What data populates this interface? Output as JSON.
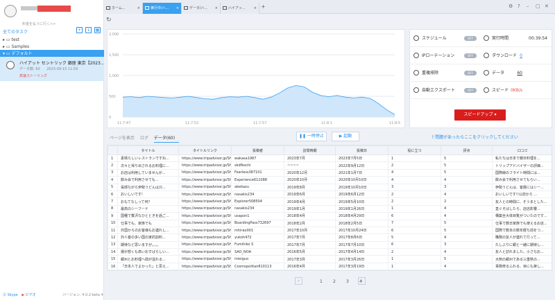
{
  "sidebar": {
    "user_hint": "料金を払うに行く>>",
    "all_tasks": "全てのタスク",
    "items": [
      {
        "label": "test"
      },
      {
        "label": "Samples"
      },
      {
        "label": "デフォルト"
      }
    ],
    "task": {
      "title": "ハイアット セントリック 銀座 東京【2023...",
      "date_label": "データ数: 60",
      "date": "2023-09-15 11:59",
      "status": "高速ストーリング"
    },
    "footer": {
      "skype": "Skype",
      "video": "ビデオ",
      "version": "バージョン: 4.0.2-beta 4"
    }
  },
  "tabs": [
    {
      "label": "ホーム..."
    },
    {
      "label": "実行中/ハ..."
    },
    {
      "label": "データ/ハ..."
    },
    {
      "label": "ハイアッ..."
    }
  ],
  "chart_data": {
    "type": "area",
    "x_ticks": [
      "11:7:47",
      "11:7:52",
      "11:7:57",
      "11:8:1",
      "11:8:5"
    ],
    "y_ticks": [
      "2,000",
      "1,500",
      "1,000",
      "500",
      "0"
    ],
    "ylim": [
      0,
      2000
    ],
    "values": [
      480,
      490,
      470,
      500,
      485,
      470,
      460,
      480,
      500,
      470,
      440,
      430,
      470,
      490,
      480,
      500,
      470,
      430,
      480,
      580,
      700,
      760,
      730,
      600,
      520,
      490,
      520,
      480,
      460,
      480,
      450,
      330,
      180,
      60
    ],
    "color": "#3aa0f0"
  },
  "panel": {
    "schedule": "スケジュール",
    "schedule_state": "OFF",
    "runtime": "実行時間",
    "runtime_val": "00:39:54",
    "ip": "IPローテーション",
    "ip_state": "OFF",
    "download": "ダウンロード",
    "download_val": "0",
    "dedupe": "重複排除",
    "dedupe_state": "OFF",
    "data": "データ",
    "data_val": "60",
    "export": "自動エクスポート",
    "export_state": "OFF",
    "speed": "スピード",
    "speed_val": "0KB/s",
    "speedup": "スピードアップ"
  },
  "main": {
    "tab_page": "ページを表示",
    "tab_log": "ログ",
    "tab_data": "データ(60)",
    "pause": "一時停止",
    "start": "起動",
    "help": "問題があったらここをクリックしてください"
  },
  "table": {
    "headers": [
      "",
      "タイトル",
      "タイトルリンク",
      "投稿者",
      "訪問時期",
      "投稿日",
      "役に立つ",
      "評点",
      "口コミ"
    ],
    "rows": [
      [
        "1",
        "素晴らしいレストランですね...",
        "https://www.tripadvisor.jp/Sho...",
        "wakasa1987",
        "2023年7月",
        "2023年7月5日",
        "1",
        "5",
        "私たちは日本で朝日料理を..."
      ],
      [
        "2",
        "次々と帰り出されるお料理に...",
        "https://www.tripadvisor.jp/Sho...",
        "skdfkochi",
        "~~~~",
        "2022年9月12日",
        "2",
        "5",
        "トリップアドバイザーの評価..."
      ],
      [
        "3",
        "お店は利用していませんが...",
        "https://www.tripadvisor.jp/Sho...",
        "Fearless387101",
        "2020年12月",
        "2021年1月7日",
        "4",
        "5",
        "国際線のフライト時間には..."
      ],
      [
        "4",
        "飲み会で利用させても...",
        "https://www.tripadvisor.jp/Sho...",
        "Experience611088",
        "2020年10月",
        "2020年10月10日",
        "4",
        "4",
        "飲み会で利用させてもらい..."
      ],
      [
        "5",
        "張感ながら伊勢うどんは只...",
        "https://www.tripadvisor.jp/Sho...",
        "abekazu",
        "2019年8月",
        "2019年10月10日",
        "3",
        "3",
        "伊勢うどんは、客層にはシー..."
      ],
      [
        "6",
        "おいしいです!",
        "https://www.tripadvisor.jp/Sho...",
        "nasakis234",
        "2019年6月",
        "2019年6月12日",
        "2",
        "4",
        "おいしいです!!以前から ..."
      ],
      [
        "7",
        "おもてなしって何?",
        "https://www.tripadvisor.jp/Sho...",
        "Explorer508504",
        "2019年4月",
        "2019年5月10日",
        "2",
        "2",
        "友人との時間に、そうまとした..."
      ],
      [
        "8",
        "最高のシーフード",
        "https://www.tripadvisor.jp/Sho...",
        "nasakis234",
        "2019年1月",
        "2019年1月26日",
        "1",
        "4",
        "直ぐそばしたら、店店影響..."
      ],
      [
        "9",
        "国種で贅沢なひとときを過ご...",
        "https://www.tripadvisor.jp/Sho...",
        "usapon1",
        "2018年4月",
        "2018年4月29日",
        "6",
        "4",
        "構築全大体目覧がついたのです..."
      ],
      [
        "10",
        "仕事でも、家族でも",
        "https://www.tripadvisor.jp/Sho...",
        "BoardingPass732697",
        "2018年2月",
        "2018年2月5日",
        "7",
        "5",
        "仕事で数日家族でも使えるお店..."
      ],
      [
        "11",
        "外国からのお客様もお連れし...",
        "https://www.tripadvisor.jp/Sho...",
        "mhirao001",
        "2017年10月",
        "2017年10月24日",
        "6",
        "5",
        "国際で数本の数年経ち前をつ..."
      ],
      [
        "12",
        "外人客の多い国の家的割料...",
        "https://www.tripadvisor.jp/Sho...",
        "yukoh472",
        "2017年7月",
        "2017年8月6日",
        "5",
        "4",
        "職務の友人が連れて行って..."
      ],
      [
        "13",
        "期待など思いますが。。。。",
        "https://www.tripadvisor.jp/Sho...",
        "Fumihiko S",
        "2017年7月",
        "2017年7月10日",
        "6",
        "3",
        "久しぶりに銀と一緒に期待し..."
      ],
      [
        "14",
        "揚が想くも高いおすばらしい...",
        "https://www.tripadvisor.jp/Sho...",
        "SAO_NOA",
        "2016年5月",
        "2017年4月14日",
        "2",
        "4",
        "友人と訪れました。小さなお..."
      ],
      [
        "15",
        "銀州とお料理へ興が溢れる...",
        "https://www.tripadvisor.jp/Sho...",
        "mieiguo",
        "2017年3月",
        "2017年3月26日",
        "1",
        "5",
        "大剤の銀州である三重県の..."
      ],
      [
        "16",
        "「日本人でよかった」と思え...",
        "https://www.tripadvisor.jp/Sho...",
        "Cosmopolitan810113",
        "2016年4月",
        "2017年3月19日",
        "1",
        "4",
        "事態修るふれる、目にも楽し..."
      ]
    ]
  },
  "pager": {
    "pages": [
      "1",
      "2",
      "3",
      "4"
    ]
  }
}
